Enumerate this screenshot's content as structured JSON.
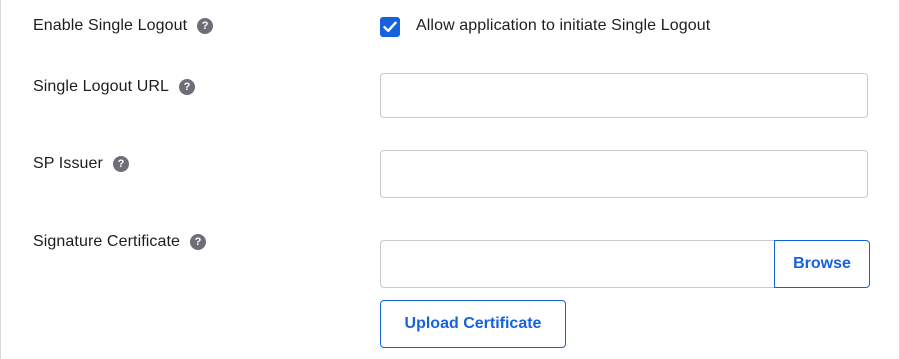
{
  "fields": {
    "single_logout": {
      "label": "Enable Single Logout",
      "help": "?",
      "checkbox_label": "Allow application to initiate Single Logout",
      "checked": true
    },
    "logout_url": {
      "label": "Single Logout URL",
      "help": "?",
      "value": "",
      "placeholder": ""
    },
    "sp_issuer": {
      "label": "SP Issuer",
      "help": "?",
      "value": "",
      "placeholder": ""
    },
    "signature_certificate": {
      "label": "Signature Certificate",
      "help": "?",
      "browse_label": "Browse",
      "upload_label": "Upload Certificate"
    }
  },
  "colors": {
    "accent": "#1662dd",
    "help_icon": "#6e6e78",
    "border": "#c9c9cf"
  }
}
